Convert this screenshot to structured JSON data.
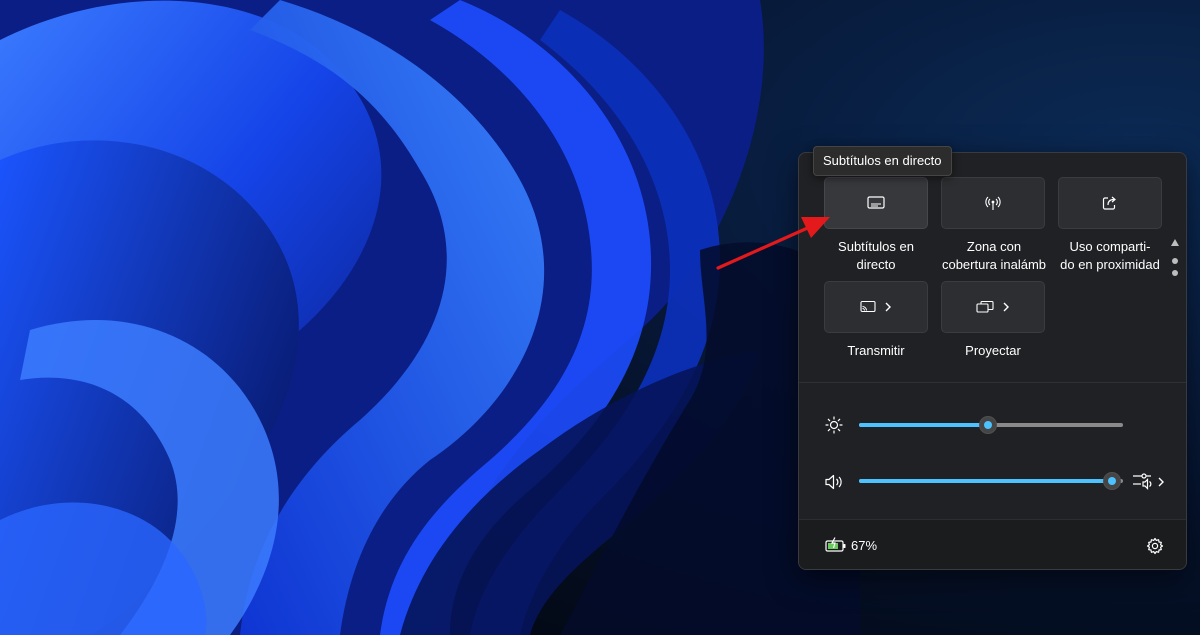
{
  "tooltip": "Subtítulos en directo",
  "quick_settings": {
    "tiles": [
      {
        "label_lines": [
          "Subtítulos en",
          "directo"
        ],
        "icon": "captions-icon"
      },
      {
        "label_lines": [
          "Zona con",
          "cobertura inalámb"
        ],
        "icon": "hotspot-icon"
      },
      {
        "label_lines": [
          "Uso comparti-",
          "do en proximidad"
        ],
        "icon": "share-icon"
      },
      {
        "label_lines": [
          "Transmitir"
        ],
        "icon": "cast-icon"
      },
      {
        "label_lines": [
          "Proyectar"
        ],
        "icon": "project-icon"
      }
    ],
    "brightness": {
      "icon": "brightness-icon",
      "level_percent": 49
    },
    "volume": {
      "icon": "speaker-icon",
      "level_percent": 96
    },
    "battery": {
      "icon": "battery-charging-icon",
      "text": "67%"
    },
    "settings_icon": "gear-icon"
  },
  "colors": {
    "accent": "#4cc2ff",
    "panel": "#202124",
    "arrow": "#e3191c"
  }
}
